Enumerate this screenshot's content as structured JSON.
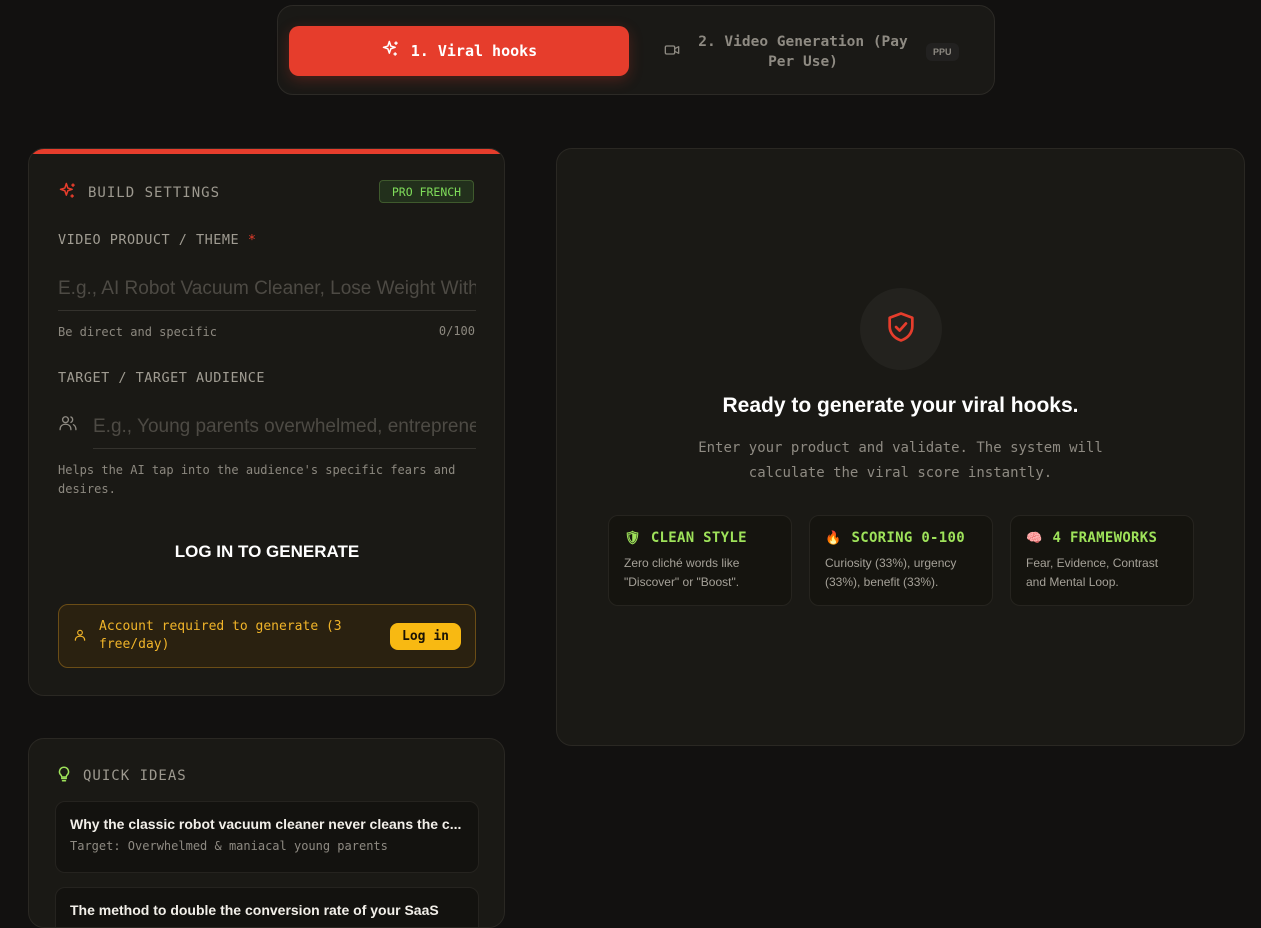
{
  "tabs": {
    "active": {
      "label": "1. Viral hooks",
      "icon": "sparkles-icon"
    },
    "inactive": {
      "label": "2. Video Generation (Pay Per Use)",
      "icon": "video-icon",
      "badge": "PPU"
    }
  },
  "settings": {
    "title": "BUILD SETTINGS",
    "badge": "PRO FRENCH",
    "product": {
      "label": "VIDEO PRODUCT / THEME",
      "required_mark": "*",
      "placeholder": "E.g., AI Robot Vacuum Cleaner, Lose Weight Without Dieting",
      "value": "",
      "hint": "Be direct and specific",
      "counter": "0/100"
    },
    "audience": {
      "label": "TARGET / TARGET AUDIENCE",
      "placeholder": "E.g., Young parents overwhelmed, entrepreneurs",
      "value": "",
      "hint": "Helps the AI tap into the audience's specific fears and desires."
    },
    "generate_label": "LOG IN TO GENERATE",
    "account_notice": "Account required to generate (3 free/day)",
    "login_label": "Log in"
  },
  "ideas": {
    "title": "QUICK IDEAS",
    "items": [
      {
        "title": "Why the classic robot vacuum cleaner never cleans the c...",
        "target": "Target: Overwhelmed & maniacal young parents"
      },
      {
        "title": "The method to double the conversion rate of your SaaS",
        "target": ""
      }
    ]
  },
  "result": {
    "title": "Ready to generate your viral hooks.",
    "subtitle": "Enter your product and validate. The system will calculate the viral score instantly.",
    "features": [
      {
        "emoji": "🛡",
        "title": "CLEAN STYLE",
        "desc": "Zero cliché words like \"Discover\" or \"Boost\"."
      },
      {
        "emoji": "🔥",
        "title": "SCORING 0-100",
        "desc": "Curiosity (33%), urgency (33%), benefit (33%)."
      },
      {
        "emoji": "🧠",
        "title": "4 FRAMEWORKS",
        "desc": "Fear, Evidence, Contrast and Mental Loop."
      }
    ]
  },
  "colors": {
    "accent": "#e63d2c",
    "green": "#9ee25a",
    "warning": "#f0b429",
    "background": "#121110"
  }
}
